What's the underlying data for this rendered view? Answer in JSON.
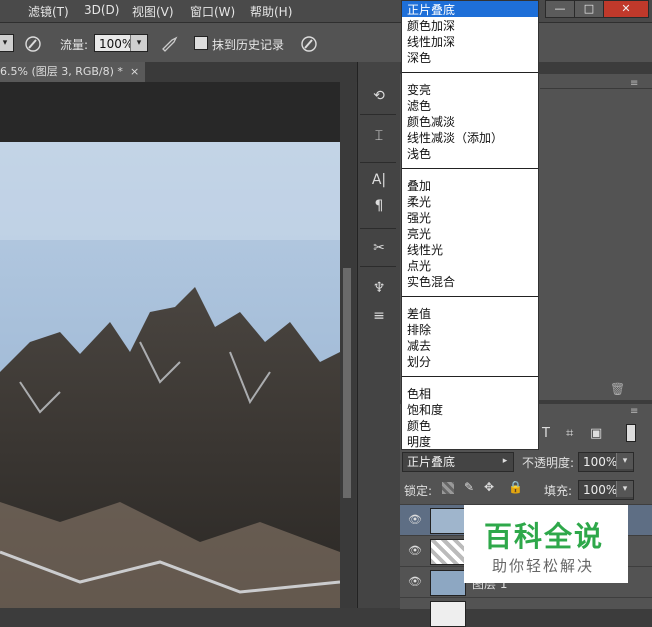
{
  "menubar": {
    "items": [
      "滤镜(T)",
      "3D(D)",
      "视图(V)",
      "窗口(W)",
      "帮助(H)"
    ],
    "window_buttons": [
      "—",
      "□",
      "✕"
    ]
  },
  "options": {
    "flow_label": "流量:",
    "flow_value": "100%",
    "history_label": "抹到历史记录"
  },
  "document": {
    "tab_title": "6.5% (图层 3, RGB/8) *",
    "close": "×"
  },
  "blend_dropdown": {
    "selected": "正片叠底",
    "groups": [
      [
        "正片叠底",
        "颜色加深",
        "线性加深",
        "深色"
      ],
      [
        "变亮",
        "滤色",
        "颜色减淡",
        "线性减淡（添加）",
        "浅色"
      ],
      [
        "叠加",
        "柔光",
        "强光",
        "亮光",
        "线性光",
        "点光",
        "实色混合"
      ],
      [
        "差值",
        "排除",
        "减去",
        "划分"
      ],
      [
        "色相",
        "饱和度",
        "颜色",
        "明度"
      ]
    ]
  },
  "layers": {
    "blend_value": "正片叠底",
    "opacity_label": "不透明度:",
    "opacity_value": "100%",
    "lock_label": "锁定:",
    "fill_label": "填充:",
    "fill_value": "100%",
    "layer3_name": "图层 1"
  },
  "watermark": {
    "title": "百科全说",
    "subtitle": "助你轻松解决"
  },
  "colors": {
    "selected_bg": "#1e6fd8",
    "watermark_green": "#2ea84a"
  },
  "icons": {
    "brush": "brush-icon",
    "airbrush": "airbrush-icon",
    "tablet": "tablet-pressure-icon"
  }
}
